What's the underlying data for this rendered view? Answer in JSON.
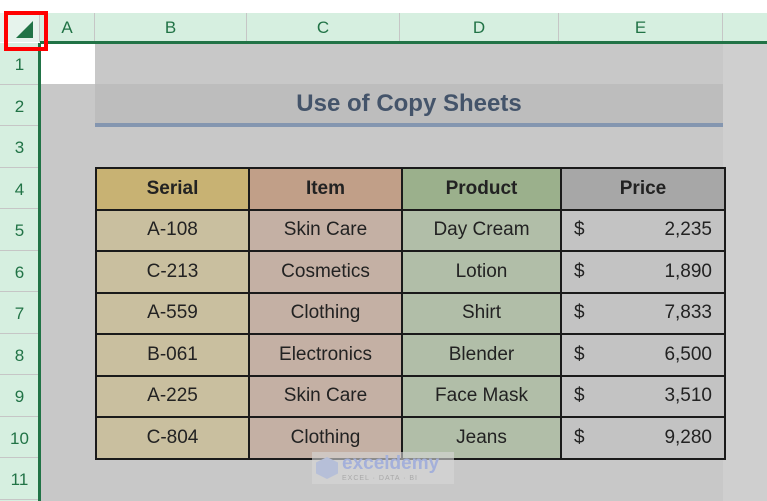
{
  "columns": [
    "A",
    "B",
    "C",
    "D",
    "E"
  ],
  "rows": [
    "1",
    "2",
    "3",
    "4",
    "5",
    "6",
    "7",
    "8",
    "9",
    "10",
    "11"
  ],
  "title": "Use of Copy Sheets",
  "table": {
    "headers": [
      "Serial",
      "Item",
      "Product",
      "Price"
    ],
    "rows": [
      {
        "serial": "A-108",
        "item": "Skin Care",
        "product": "Day Cream",
        "currency": "$",
        "price": "2,235"
      },
      {
        "serial": "C-213",
        "item": "Cosmetics",
        "product": "Lotion",
        "currency": "$",
        "price": "1,890"
      },
      {
        "serial": "A-559",
        "item": "Clothing",
        "product": "Shirt",
        "currency": "$",
        "price": "7,833"
      },
      {
        "serial": "B-061",
        "item": "Electronics",
        "product": "Blender",
        "currency": "$",
        "price": "6,500"
      },
      {
        "serial": "A-225",
        "item": "Skin Care",
        "product": "Face Mask",
        "currency": "$",
        "price": "3,510"
      },
      {
        "serial": "C-804",
        "item": "Clothing",
        "product": "Jeans",
        "currency": "$",
        "price": "9,280"
      }
    ]
  },
  "watermark": {
    "name": "exceldemy",
    "tagline": "EXCEL · DATA · BI"
  },
  "colors": {
    "excel_green": "#217346",
    "highlight_red": "#ff0000",
    "title_text": "#44546a",
    "title_border": "#8496b0"
  }
}
